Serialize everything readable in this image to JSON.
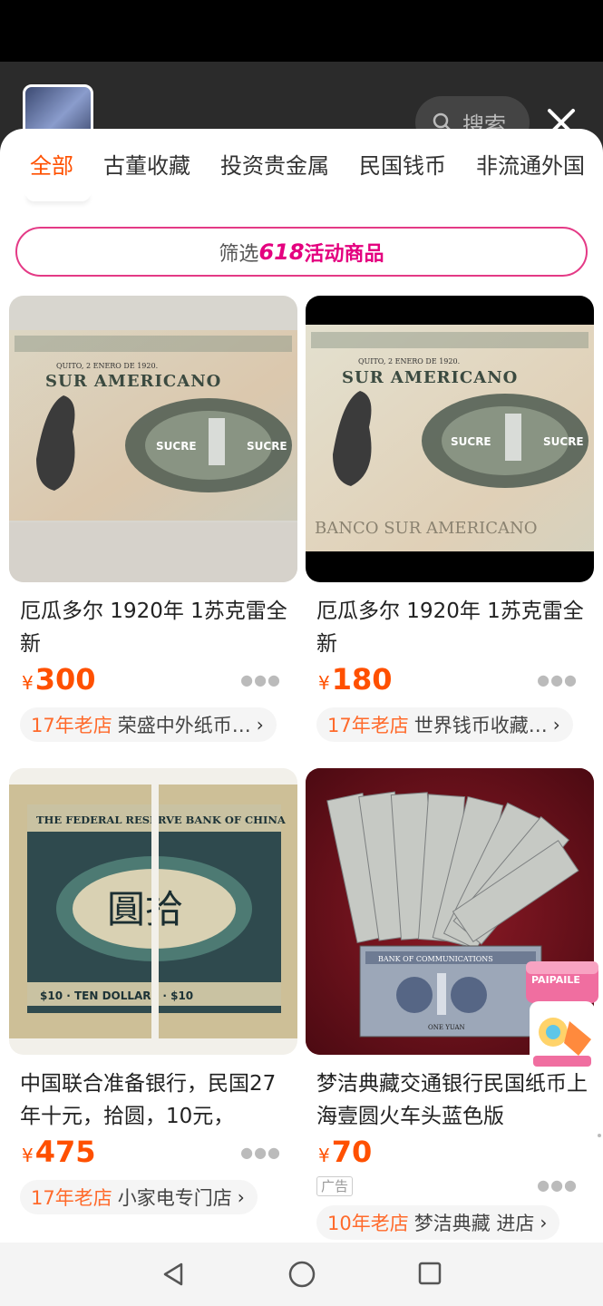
{
  "header": {
    "search_label": "搜索"
  },
  "tabs": [
    {
      "label": "全部",
      "active": true
    },
    {
      "label": "古董收藏",
      "active": false
    },
    {
      "label": "投资贵金属",
      "active": false
    },
    {
      "label": "民国钱币",
      "active": false
    },
    {
      "label": "非流通外国",
      "active": false
    }
  ],
  "filter": {
    "prefix": "筛选",
    "promo_number": "618",
    "promo_text": "活动商品"
  },
  "products": [
    {
      "title": "厄瓜多尔 1920年 1苏克雷全新",
      "currency": "¥",
      "price": "300",
      "shop_age": "17年老店",
      "shop_name": "荣盛中外纸币…",
      "chevron": "›"
    },
    {
      "title": "厄瓜多尔 1920年 1苏克雷全新",
      "currency": "¥",
      "price": "180",
      "shop_age": "17年老店",
      "shop_name": "世界钱币收藏…",
      "chevron": "›"
    },
    {
      "title": "中国联合准备银行，民国27年十元，拾圆，10元，",
      "currency": "¥",
      "price": "475",
      "shop_age": "17年老店",
      "shop_name": "小家电专门店",
      "chevron": "›"
    },
    {
      "title": "梦洁典藏交通银行民国纸币上海壹圆火车头蓝色版",
      "currency": "¥",
      "price": "70",
      "ad_label": "广告",
      "shop_age": "10年老店",
      "shop_name": "梦洁典藏 进店",
      "chevron": "›"
    }
  ],
  "banknote_text": {
    "ecuador_bank": "SUR AMERICANO",
    "ecuador_denom": "SUCRE",
    "ecuador_city": "QUITO, 2 ENERO DE 1920.",
    "ecuador_footer": "BANCO SUR AMERICANO",
    "china_bank": "THE FEDERAL RESERVE BANK OF CHINA",
    "china_denom": "圓拾",
    "china_value": "$10 · TEN DOLLARS · $10",
    "comm_bank": "BANK OF COMMUNICATIONS",
    "comm_value": "ONE YUAN"
  },
  "float_badge": "PAIPAILE",
  "colors": {
    "accent": "#ff5000",
    "promo": "#e4007f",
    "shop_age": "#ff6a2b"
  }
}
